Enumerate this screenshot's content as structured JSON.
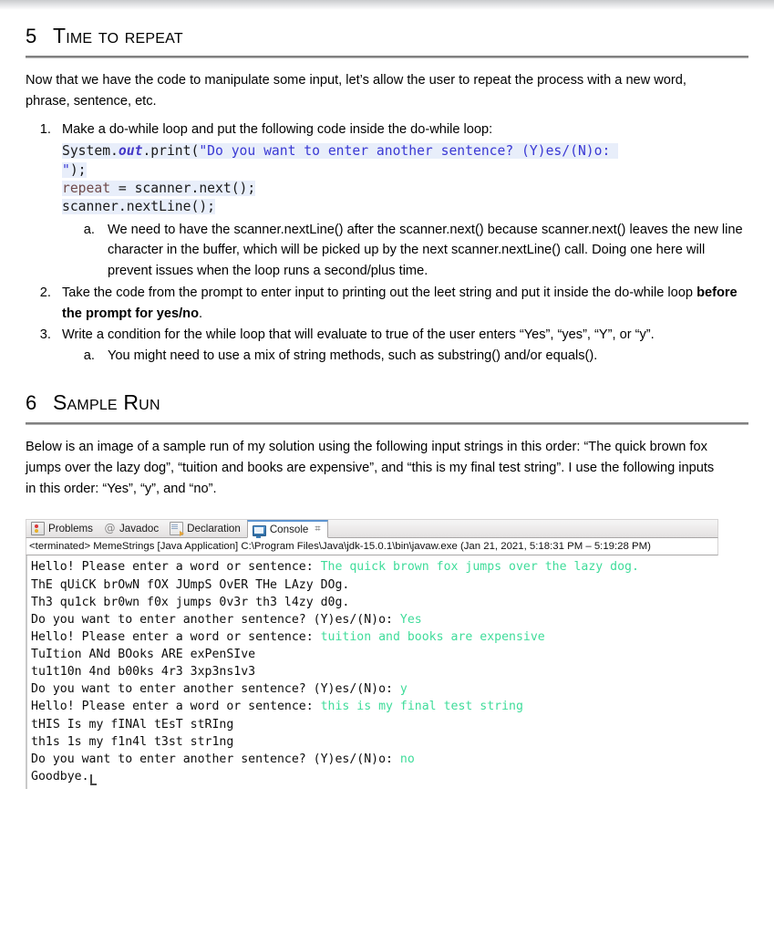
{
  "document": {
    "sections": [
      {
        "number": "5",
        "title": "Time to repeat",
        "intro": "Now that we have the code to manipulate some input, let’s allow the user to repeat the process with a new word, phrase, sentence, etc."
      },
      {
        "number": "6",
        "title": "Sample Run",
        "intro": "Below is an image of a sample run of my solution using the following input strings in this order: “The quick brown fox jumps over the lazy dog”, “tuition and books are expensive”, and “this is my final test string”. I use the following inputs in this order: “Yes”, “y”, and “no”."
      }
    ],
    "list": {
      "item1": "Make a do-while loop and put the following code inside the do-while loop:",
      "item1a": "We need to have the scanner.nextLine() after the scanner.next() because scanner.next() leaves the new line character in the buffer, which will be picked up by the next scanner.nextLine() call. Doing one here will prevent issues when the loop runs a second/plus time.",
      "item2_pre": "Take the code from the prompt to enter input to printing out the leet string and put it inside the do-while loop ",
      "item2_bold": "before the prompt for yes/no",
      "item2_post": ".",
      "item3": "Write a condition for the while loop that will evaluate to true of the user enters “Yes”, “yes”, “Y”, or “y”.",
      "item3a": "You might need to use a mix of string methods, such as substring() and/or equals()."
    },
    "code": {
      "t1": "System.",
      "t2": "out",
      "t3": ".print(",
      "t4": "\"Do you want to enter another sentence? (Y)es/(N)o: \"",
      "t5": ");",
      "t6": "repeat",
      "t7": " = scanner.next();",
      "t8": "scanner.nextLine();",
      "colors": {
        "field": "#4438c8",
        "string": "#3a39d4",
        "local": "#6f4a4a",
        "highlight": "#e8eefa"
      }
    }
  },
  "console": {
    "tabs": [
      {
        "label": "Problems",
        "icon": "problems-icon",
        "active": false
      },
      {
        "label": "Javadoc",
        "icon": "javadoc-icon",
        "active": false
      },
      {
        "label": "Declaration",
        "icon": "declaration-icon",
        "active": false
      },
      {
        "label": "Console",
        "icon": "console-icon",
        "active": true
      }
    ],
    "maximize_glyph": "⌗",
    "terminated_line": "<terminated> MemeStrings [Java Application] C:\\Program Files\\Java\\jdk-15.0.1\\bin\\javaw.exe  (Jan 21, 2021, 5:18:31 PM – 5:19:28 PM)",
    "output": [
      {
        "prompt": "Hello! Please enter a word or sentence: ",
        "input": "The quick brown fox jumps over the lazy dog."
      },
      {
        "prompt": "ThE qUiCK brOwN fOX JUmpS OvER THe LAzy DOg.",
        "input": ""
      },
      {
        "prompt": "Th3 qu1ck br0wn f0x jumps 0v3r th3 l4zy d0g.",
        "input": ""
      },
      {
        "prompt": "Do you want to enter another sentence? (Y)es/(N)o: ",
        "input": "Yes"
      },
      {
        "prompt": "Hello! Please enter a word or sentence: ",
        "input": "tuition and books are expensive"
      },
      {
        "prompt": "TuItion ANd BOoks ARE exPenSIve",
        "input": ""
      },
      {
        "prompt": "tu1t10n 4nd b00ks 4r3 3xp3ns1v3",
        "input": ""
      },
      {
        "prompt": "Do you want to enter another sentence? (Y)es/(N)o: ",
        "input": "y"
      },
      {
        "prompt": "Hello! Please enter a word or sentence: ",
        "input": "this is my final test string"
      },
      {
        "prompt": "tHIS Is my fINAl tEsT stRIng",
        "input": ""
      },
      {
        "prompt": "th1s 1s my f1n4l t3st str1ng",
        "input": ""
      },
      {
        "prompt": "Do you want to enter another sentence? (Y)es/(N)o: ",
        "input": "no"
      },
      {
        "prompt": "Goodbye.",
        "input": ""
      }
    ],
    "colors": {
      "user_input": "#3fdc9a",
      "text": "#0d0d0d"
    }
  }
}
